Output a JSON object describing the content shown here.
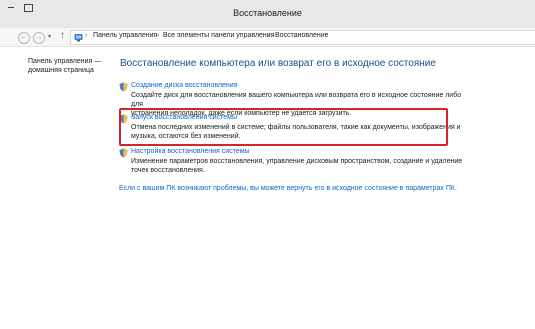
{
  "window": {
    "title": "Восстановление"
  },
  "nav": {
    "back_glyph": "←",
    "forward_glyph": "→",
    "history_glyph": "▾",
    "up_glyph": "↑",
    "breadcrumbs": [
      "Панель управления",
      "Все элементы панели управления",
      "Восстановление"
    ],
    "separator": "›"
  },
  "sidebar": {
    "home_link_line1": "Панель управления —",
    "home_link_line2": "домашняя страница"
  },
  "main": {
    "heading": "Восстановление компьютера или возврат его в исходное состояние",
    "sections": [
      {
        "link": "Создание диска восстановления",
        "desc_line1": "Создайте диск для восстановления вашего компьютера или возврата его в исходное состояние либо для",
        "desc_line2": "устранения неполадок, даже если компьютер не удается загрузить."
      },
      {
        "link": "Запуск восстановления системы",
        "desc_line1": "Отмена последних изменений в системе; файлы пользователя, такие как документы, изображения и",
        "desc_line2": "музыка, остаются без изменений."
      },
      {
        "link": "Настройка восстановления системы",
        "desc_line1": "Изменение параметров восстановления, управление дисковым пространством, создание и удаление",
        "desc_line2": "точек восстановления."
      }
    ],
    "bottom_link": "Если с вашим ПК возникают проблемы, вы можете вернуть его в исходное состояние в параметрах ПК."
  },
  "colors": {
    "accent_link": "#0e66c5",
    "heading": "#1a4f8b",
    "highlight": "#d42626"
  }
}
